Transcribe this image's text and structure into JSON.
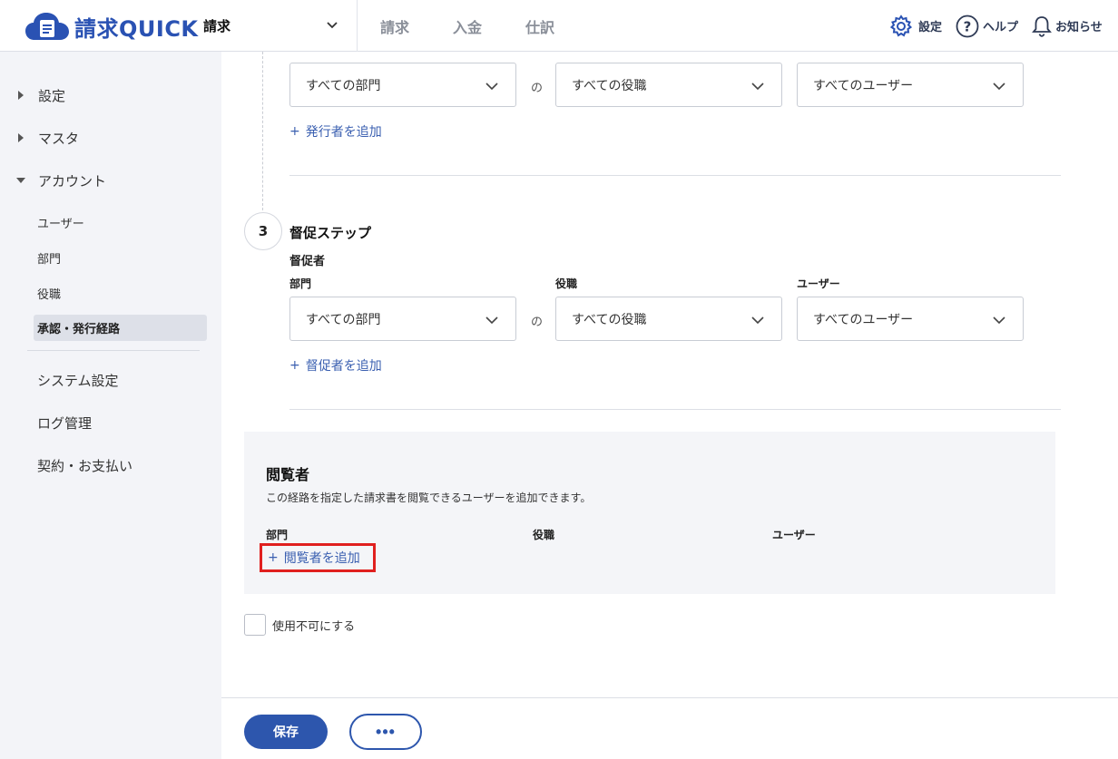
{
  "header": {
    "logo_text": "請求QUICK",
    "product_select": "請求",
    "nav": [
      {
        "label": "請求"
      },
      {
        "label": "入金"
      },
      {
        "label": "仕訳"
      }
    ],
    "tools": {
      "settings": "設定",
      "help": "ヘルプ",
      "notifications": "お知らせ"
    }
  },
  "sidebar": {
    "groups": [
      {
        "label": "設定",
        "expanded": false
      },
      {
        "label": "マスタ",
        "expanded": false
      },
      {
        "label": "アカウント",
        "expanded": true
      }
    ],
    "account_items": [
      "ユーザー",
      "部門",
      "役職"
    ],
    "active_item": "承認・発行経路",
    "bottom_items": [
      "システム設定",
      "ログ管理",
      "契約・お支払い"
    ]
  },
  "issuer_step": {
    "dept_select": "すべての部門",
    "no": "の",
    "role_select": "すべての役職",
    "user_select": "すべてのユーザー",
    "add_link": "発行者を追加"
  },
  "dunning_step": {
    "number": "3",
    "title": "督促ステップ",
    "subtitle": "督促者",
    "dept_label": "部門",
    "role_label": "役職",
    "user_label": "ユーザー",
    "dept_select": "すべての部門",
    "no": "の",
    "role_select": "すべての役職",
    "user_select": "すべてのユーザー",
    "add_link": "督促者を追加"
  },
  "viewers": {
    "title": "閲覧者",
    "description": "この経路を指定した請求書を閲覧できるユーザーを追加できます。",
    "dept_label": "部門",
    "role_label": "役職",
    "user_label": "ユーザー",
    "add_link": "閲覧者を追加"
  },
  "disable_checkbox": {
    "label": "使用不可にする",
    "checked": false
  },
  "footer": {
    "save": "保存",
    "more": "•••"
  },
  "colors": {
    "brand": "#2a52b3",
    "primary_button": "#2d56ad",
    "link": "#3a5fb0",
    "highlight": "#e0201f"
  }
}
